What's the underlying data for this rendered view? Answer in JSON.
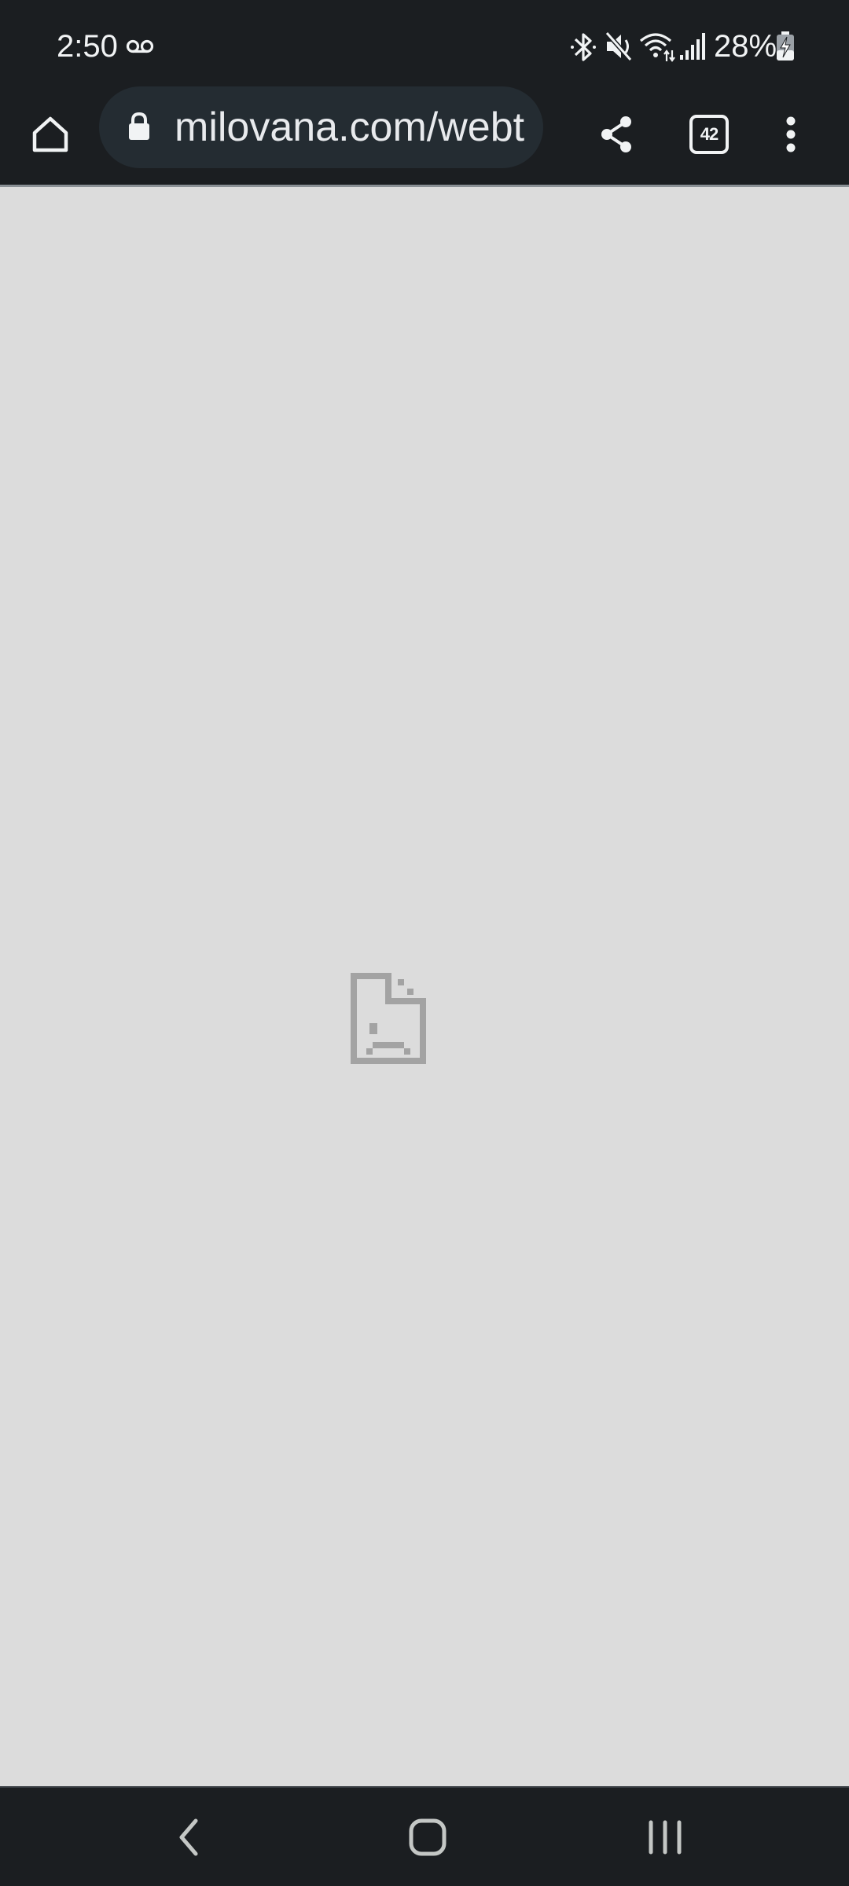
{
  "status_bar": {
    "time": "2:50",
    "battery_percent": "28%",
    "icons": [
      "voicemail-icon",
      "bluetooth-icon",
      "mute-icon",
      "wifi-icon",
      "signal-icon",
      "battery-charging-icon"
    ]
  },
  "toolbar": {
    "url": "milovana.com/webteases/",
    "tab_count": "42",
    "icons": [
      "home-icon",
      "lock-icon",
      "share-icon",
      "tabs-icon",
      "more-vert-icon"
    ]
  },
  "content": {
    "state": "broken-page",
    "icon": "sad-page-icon"
  },
  "nav_bar": {
    "icons": [
      "back-icon",
      "home-icon",
      "recents-icon"
    ]
  },
  "colors": {
    "system_bar_bg": "#1b1e21",
    "address_bar_bg": "#242c32",
    "content_bg": "#dcdcdc",
    "broken_icon": "#a3a3a3",
    "foreground": "#f1f3f4"
  }
}
